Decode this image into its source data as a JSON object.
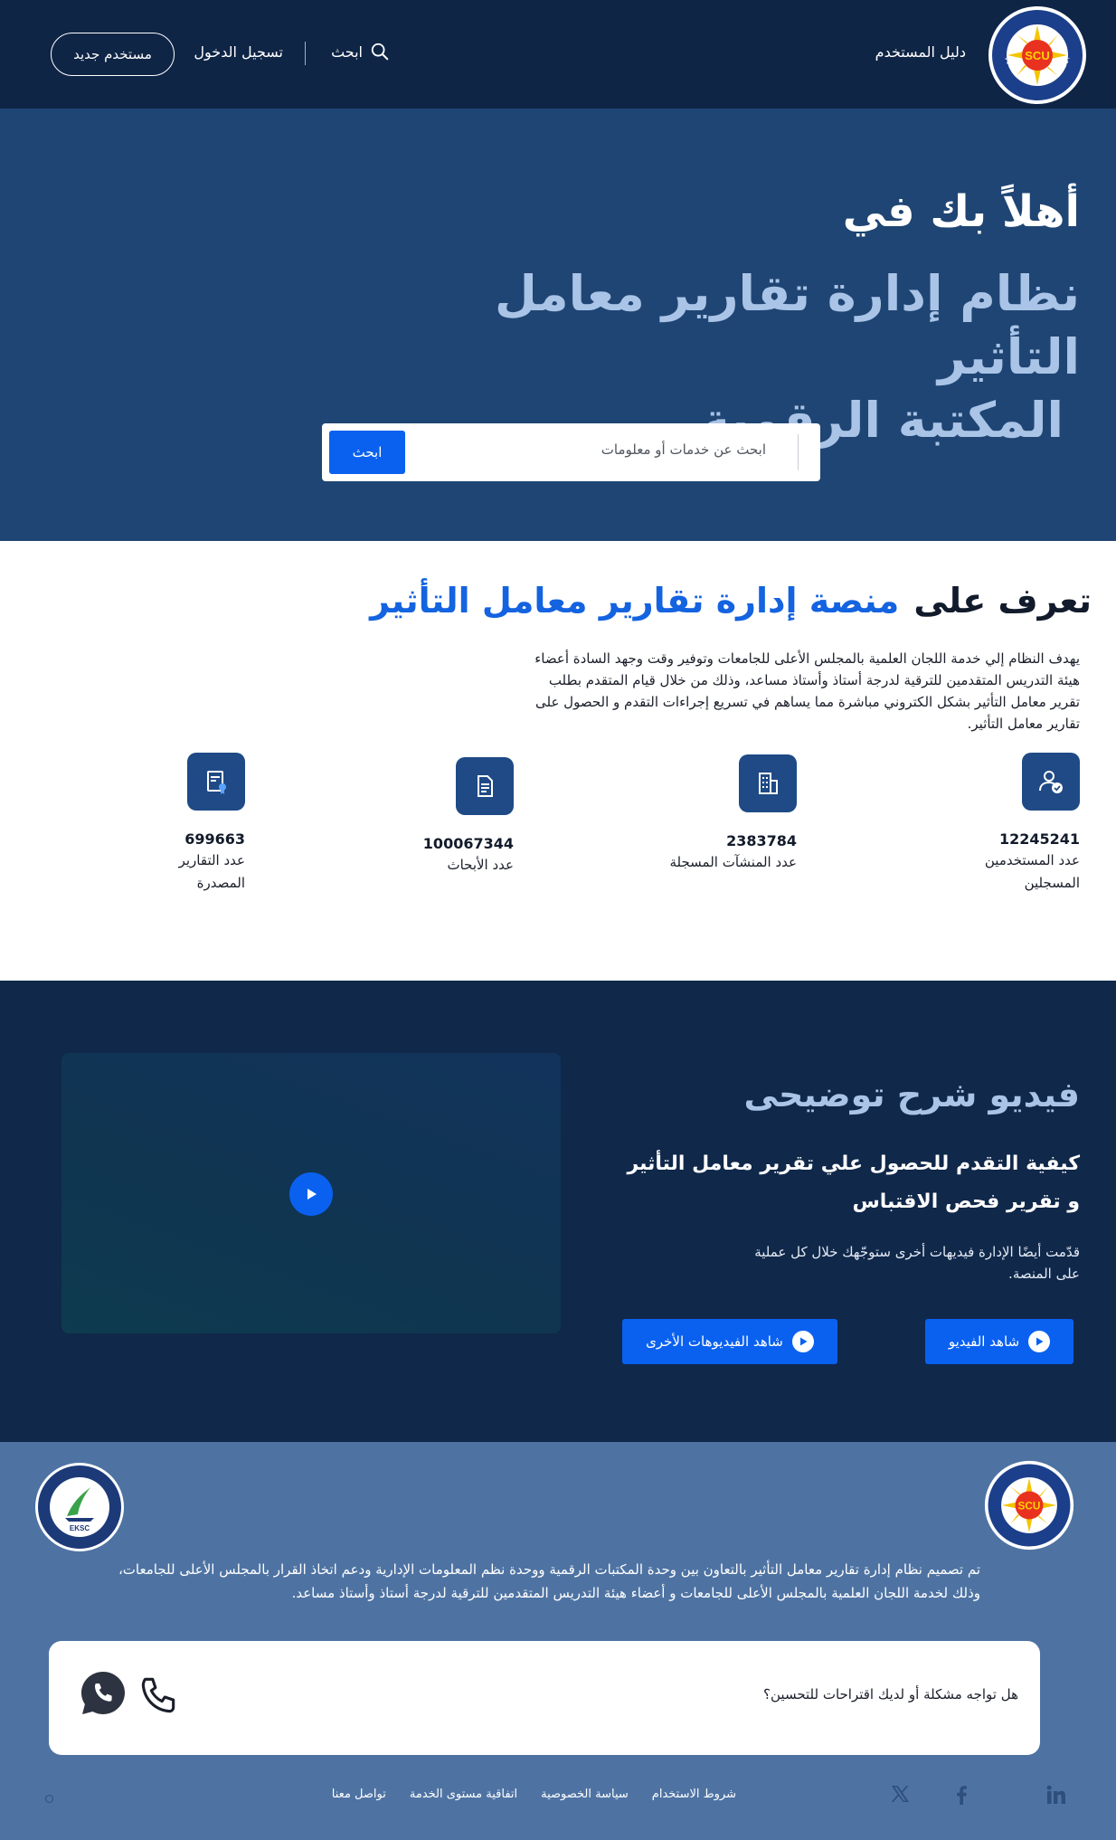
{
  "header": {
    "logo_text": "المجلس الأعلى للجامعات SCU SUPREME COUNCIL OF UNIVERSITIES",
    "user_guide": "دليل المستخدم",
    "search": "ابحث",
    "login": "تسجيل الدخول",
    "register": "مستخدم جديد"
  },
  "hero": {
    "welcome": "أهلاً بك في",
    "title_line1": "نظام إدارة تقارير معامل التأثير",
    "title_line2": "المكتبة الرقمية",
    "search_placeholder": "ابحث عن خدمات أو معلومات",
    "search_button": "ابحث"
  },
  "about": {
    "title_prefix": "تعرف على",
    "title_highlight": "منصة إدارة تقارير معامل التأثير",
    "description": "يهدف النظام إلي خدمة اللجان العلمية بالمجلس الأعلى للجامعات وتوفير وقت وجهد السادة أعضاء هيئة التدريس المتقدمين للترقية لدرجة أستاذ وأستاذ مساعد، وذلك من خلال قيام المتقدم بطلب تقرير معامل التأثير بشكل الكتروني مباشرة مما يساهم في تسريع إجراءات التقدم و الحصول على تقارير معامل التأثير.",
    "stats": [
      {
        "icon": "user-check-icon",
        "value": "12245241",
        "label": "عدد المستخدمين المسجلين"
      },
      {
        "icon": "building-icon",
        "value": "2383784",
        "label": "عدد المنشآت المسجلة"
      },
      {
        "icon": "document-icon",
        "value": "100067344",
        "label": "عدد الأبحاث"
      },
      {
        "icon": "certificate-icon",
        "value": "699663",
        "label": "عدد التقارير المصدرة"
      }
    ]
  },
  "video": {
    "title": "فيديو شرح توضيحى",
    "subtitle_line1": "كيفية التقدم للحصول علي تقرير معامل التأثير",
    "subtitle_line2": "و تقرير فحص الاقتباس",
    "description": "قدّمت أيضًا الإدارة فيديهات أخرى ستوجّهك خلال كل عملية على المنصة.",
    "watch_button": "شاهد الفيديو",
    "more_button": "شاهد الفيديوهات الأخرى"
  },
  "footer": {
    "left_logo_text": "EKSC Electronic & Knowledge Services Center",
    "description_line1": "تم تصميم نظام إدارة تقارير معامل التأثير بالتعاون بين وحدة المكتبات الرقمية ووحدة نظم المعلومات الإدارية ودعم اتخاذ القرار بالمجلس الأعلى للجامعات،",
    "description_line2": "وذلك لخدمة اللجان العلمية بالمجلس الأعلى للجامعات و أعضاء هيئة التدريس المتقدمين للترقية لدرجة أستاذ وأستاذ مساعد.",
    "feedback_text": "هل تواجه مشكلة أو لديك اقتراحات للتحسين؟",
    "links": [
      "شروط الاستخدام",
      "سياسة الخصوصية",
      "اتفاقية مستوى الخدمة",
      "تواصل معنا"
    ]
  },
  "colors": {
    "header_bg": "#0f2546",
    "hero_bg": "#1f4574",
    "accent": "#0a61f0",
    "highlight": "#1463e0",
    "video_bg": "#10284a",
    "footer_bg": "#4e73a3"
  }
}
